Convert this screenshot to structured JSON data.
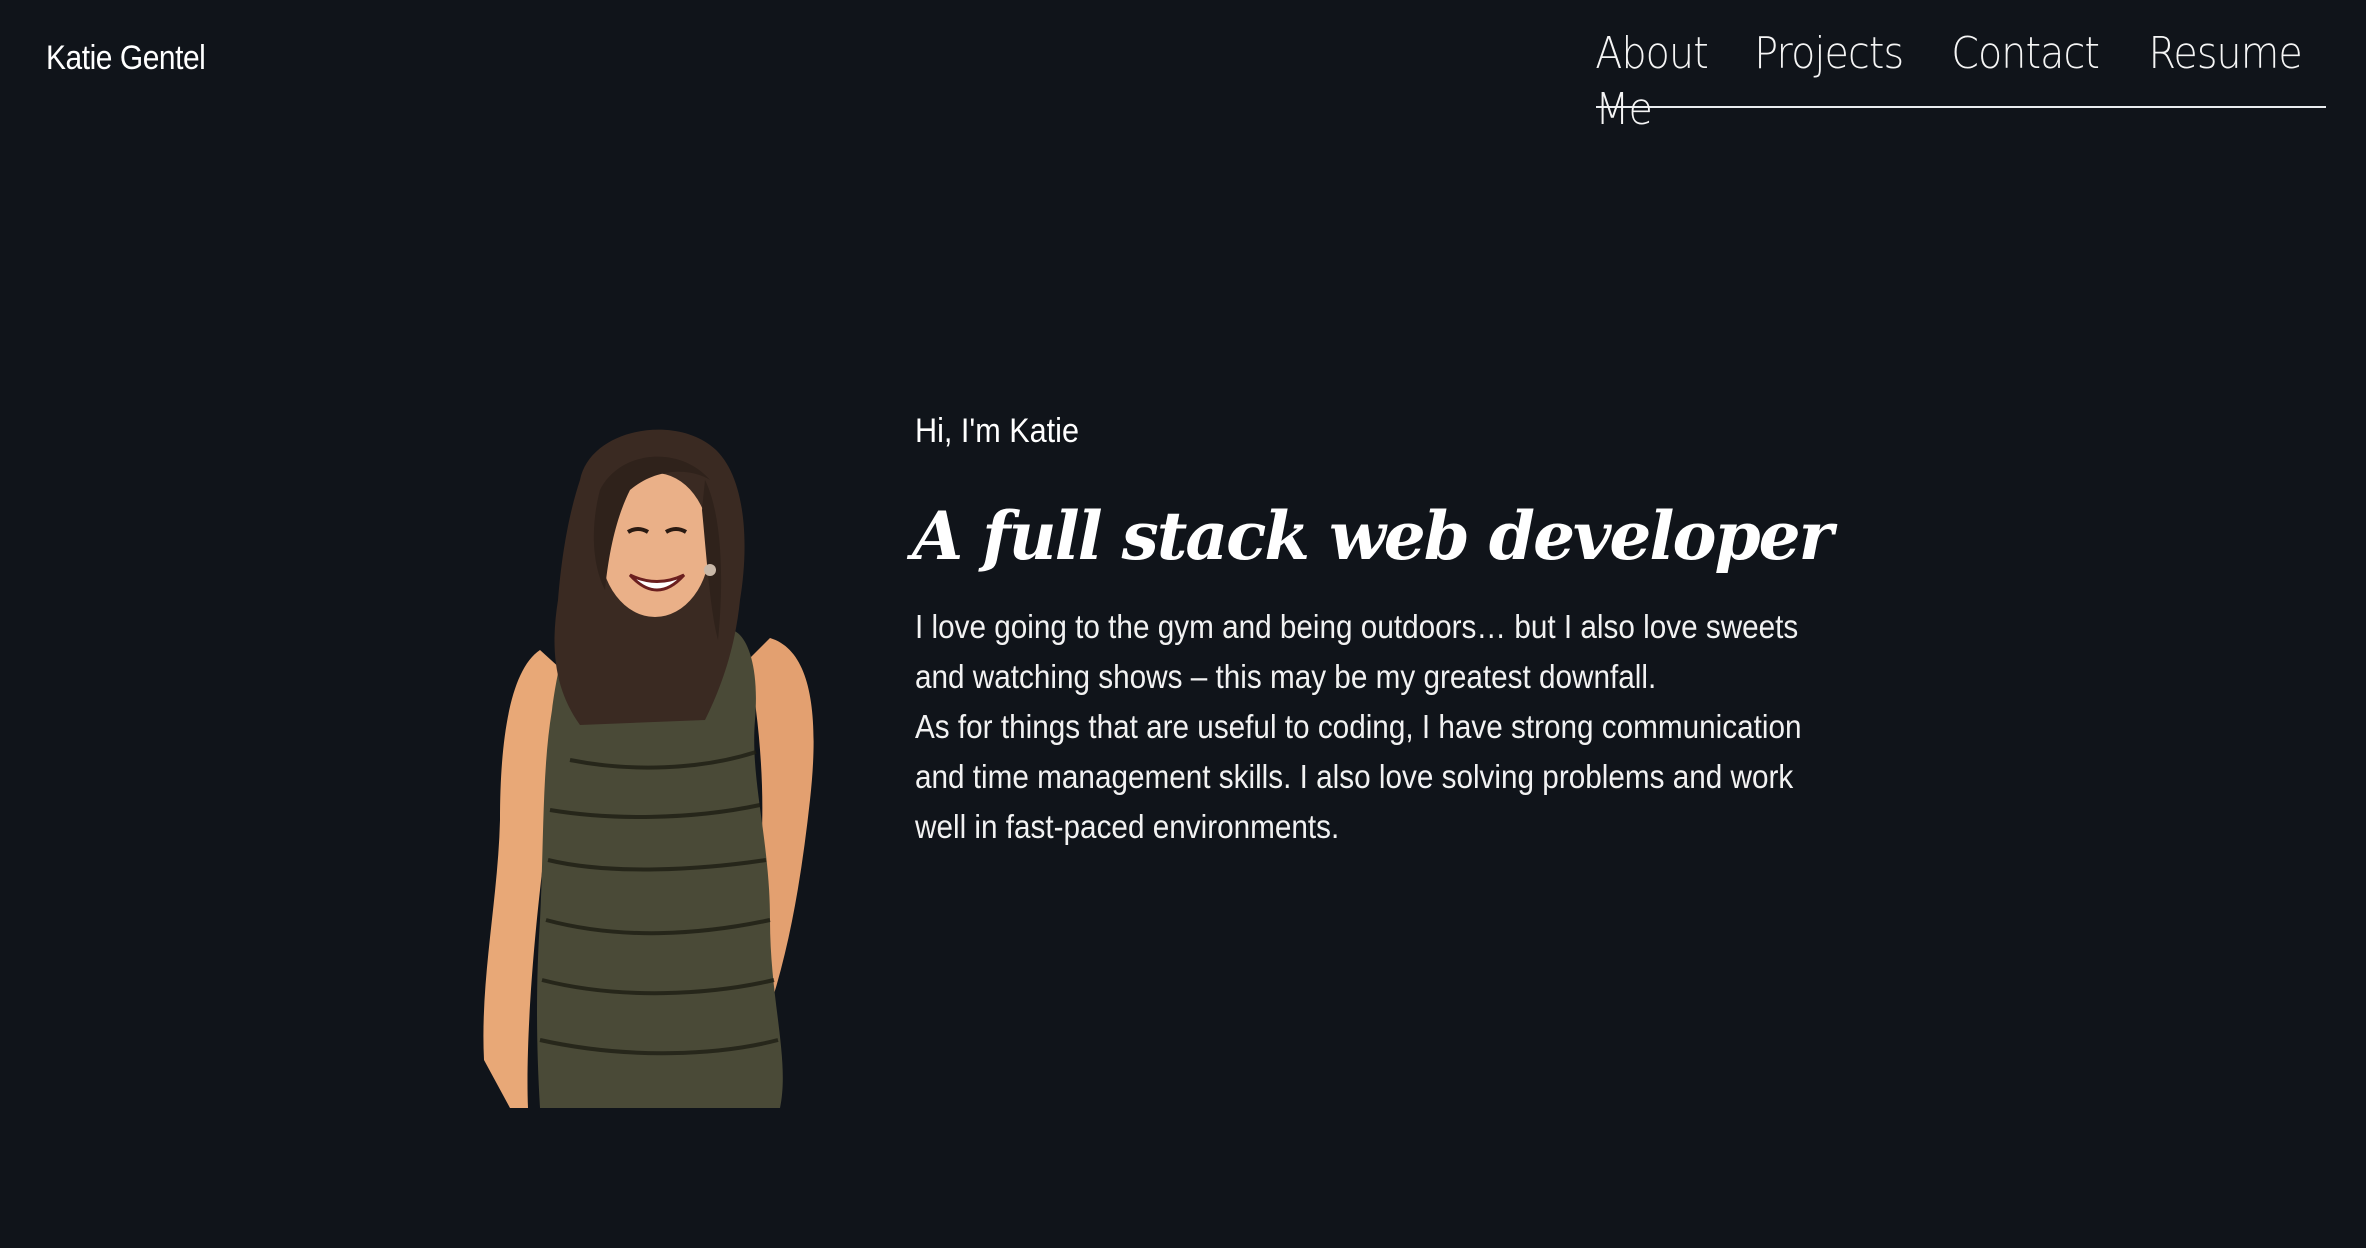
{
  "header": {
    "brand": "Katie Gentel",
    "nav": [
      {
        "label": "About Me"
      },
      {
        "label": "Projects"
      },
      {
        "label": "Contact"
      },
      {
        "label": "Resume"
      }
    ]
  },
  "hero": {
    "greeting": "Hi, I'm Katie",
    "headline": "A full stack web developer",
    "bio": [
      "I love going to the gym and being outdoors… but I also love sweets and watching shows – this may be my greatest downfall.",
      "As for things that are useful to coding, I have strong communication and time management skills. I also love solving problems and work well in fast-paced environments."
    ]
  },
  "colors": {
    "background": "#10141a",
    "text": "#ffffff",
    "nav_underline": "#e9ecef"
  }
}
